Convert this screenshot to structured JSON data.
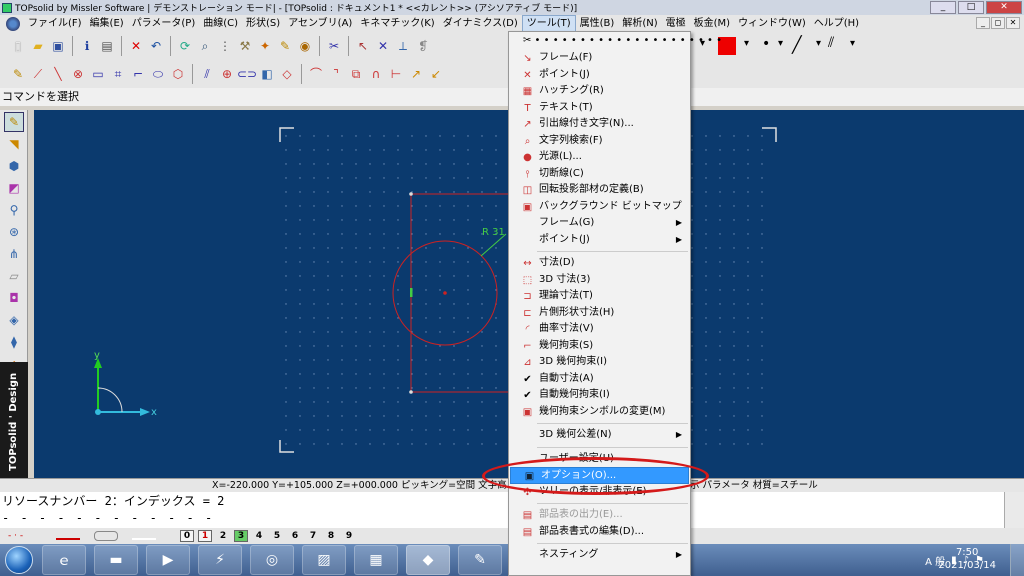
{
  "window": {
    "title": "TOPsolid by Missler Software | デモンストレーション モード| - [TOPsolid : ドキュメント1 *  <<カレント>> (アシソアティブ モード)]",
    "controls": [
      "_",
      "□",
      "✕"
    ]
  },
  "menu": [
    "ファイル(F)",
    "編集(E)",
    "パラメータ(P)",
    "曲線(C)",
    "形状(S)",
    "アセンブリ(A)",
    "キネマチック(K)",
    "ダイナミクス(D)",
    "ツール(T)",
    "属性(B)",
    "解析(N)",
    "電極",
    "板金(M)",
    "ウィンドウ(W)",
    "ヘルプ(H)"
  ],
  "menu_active_index": 8,
  "mdi_controls": [
    "_",
    "◻",
    "✕"
  ],
  "command_prompt": "コマンドを選択",
  "brand_label": "TOPsolid ' Design",
  "canvas": {
    "dimension_label": "R 31",
    "axis_x": "x",
    "axis_y": "y"
  },
  "status": "X=-220.000  Y=+105.000  Z=+000.000  ピッキング=空間  文字高…                              …角度=0  レイヤー= 3  小数桁= 3  非表示  パラメータ  材質=スチール",
  "messages": [
    "リソースナンバー 2：インデックス = 2",
    "- - - - - - - - - - - -"
  ],
  "layers": {
    "numbers": [
      "0",
      "1",
      "2",
      "3",
      "4",
      "5",
      "6",
      "7",
      "8",
      "9"
    ],
    "current": "3"
  },
  "taskbar": {
    "apps": [
      "folder",
      "media",
      "plug",
      "chrome",
      "book",
      "calc",
      "topsolid",
      "paint"
    ],
    "time": "7:50",
    "date": "2021/03/14",
    "ime": "A 般"
  },
  "colors": {
    "canvas_bg": "#0b3a6e",
    "grid_dot": "#6f8fb8",
    "sketch_red": "#cc2222",
    "highlight": "#3399ff",
    "annotation_red": "#d41a1a"
  },
  "tools_menu": {
    "items": [
      {
        "label": "フレーム(F)",
        "icon": "frame-icon"
      },
      {
        "label": "ポイント(J)",
        "icon": "point-icon"
      },
      {
        "label": "ハッチング(R)",
        "icon": "hatch-icon"
      },
      {
        "label": "テキスト(T)",
        "icon": "text-icon"
      },
      {
        "label": "引出線付き文字(N)...",
        "icon": "leader-icon"
      },
      {
        "label": "文字列検索(F)",
        "icon": "search-icon"
      },
      {
        "label": "光源(L)...",
        "icon": "light-icon"
      },
      {
        "label": "切断線(C)",
        "icon": "cutline-icon"
      },
      {
        "label": "回転投影部材の定義(B)",
        "icon": "revolve-icon"
      },
      {
        "label": "バックグラウンド ビットマップ",
        "icon": "bitmap-icon"
      },
      {
        "label": "フレーム(G)",
        "icon": "",
        "submenu": true
      },
      {
        "label": "ポイント(J)",
        "icon": "",
        "submenu": true
      },
      {
        "label": "寸法(D)",
        "icon": "dim-icon",
        "sep_before": true
      },
      {
        "label": "3D 寸法(3)",
        "icon": "dim3d-icon"
      },
      {
        "label": "理論寸法(T)",
        "icon": "theodim-icon"
      },
      {
        "label": "片側形状寸法(H)",
        "icon": "halfdim-icon"
      },
      {
        "label": "曲率寸法(V)",
        "icon": "curvdim-icon"
      },
      {
        "label": "幾何拘束(S)",
        "icon": "constraint-icon"
      },
      {
        "label": "3D 幾何拘束(I)",
        "icon": "constraint3d-icon"
      },
      {
        "label": "自動寸法(A)",
        "icon": "check-icon"
      },
      {
        "label": "自動幾何拘束(I)",
        "icon": "check-icon"
      },
      {
        "label": "幾何拘束シンボルの変更(M)",
        "icon": "symbol-icon"
      },
      {
        "label": "3D 幾何公差(N)",
        "icon": "",
        "submenu": true,
        "sep_before": true
      },
      {
        "label": "ユーザー設定(U)",
        "icon": "",
        "sep_before": true
      },
      {
        "label": "オプション(O)...",
        "icon": "options-icon",
        "highlighted": true
      },
      {
        "label": "ツリーの表示/非表示(E)",
        "icon": "tree-icon"
      },
      {
        "label": "部品表の出力(E)...",
        "icon": "bom-icon",
        "disabled": true,
        "sep_before": true
      },
      {
        "label": "部品表書式の編集(D)...",
        "icon": "bomedit-icon"
      },
      {
        "label": "ネスティング",
        "icon": "",
        "submenu": true,
        "sep_before": true
      }
    ]
  }
}
